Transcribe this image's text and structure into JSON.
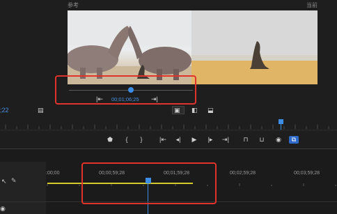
{
  "monitor": {
    "source_label": "参考",
    "program_label": "当前",
    "source_timecode": "00;01;06;25",
    "left_timecode": ";22"
  },
  "source_controls": {
    "go_in_label": "|⇤",
    "go_out_label": "⇥|"
  },
  "view_buttons": [
    {
      "name": "vertical-split-view",
      "glyph": "▣"
    },
    {
      "name": "side-by-side-view",
      "glyph": "◧"
    },
    {
      "name": "horizontal-split-view",
      "glyph": "⬓"
    }
  ],
  "transport": {
    "marker": "⬟",
    "mark_in": "{",
    "mark_out": "}",
    "go_in": "|⇤",
    "step_back": "◂|",
    "play": "▶",
    "step_forward": "|▸",
    "go_out": "⇥|",
    "lift": "⊓",
    "extract": "⊔",
    "export_frame": "◉",
    "comparison_view": "⧉"
  },
  "timeline": {
    "timecodes": [
      ":00;00",
      "00;00;59;28",
      "00;01;59;28",
      "00;02;59;28",
      "00;03;59;28"
    ],
    "work_area_color": "#d4c92a",
    "playhead_color": "#3b8de6"
  },
  "accent": {
    "highlight_box": "#e0332b",
    "blue": "#3b8de6"
  },
  "icons": {
    "snap": "↖",
    "wrench": "🔧",
    "eye": "◉"
  }
}
